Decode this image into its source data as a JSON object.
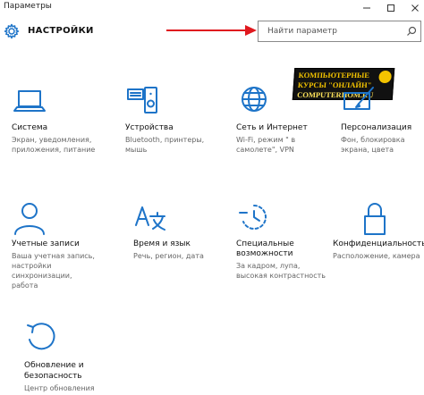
{
  "window": {
    "title": "Параметры"
  },
  "header": {
    "title": "НАСТРОЙКИ"
  },
  "search": {
    "placeholder": "Найти параметр"
  },
  "watermark": {
    "line1": "КОМПЬЮТЕРНЫЕ",
    "line2": "КУРСЫ \"ОНЛАЙН\"",
    "line3": "COMPUTERHOM.RU"
  },
  "accent": "#1e74c8",
  "tiles": [
    {
      "name": "Система",
      "icon": "laptop-icon",
      "desc": [
        "Экран, уведомления,",
        "приложения, питание"
      ]
    },
    {
      "name": "Устройства",
      "icon": "devices-icon",
      "desc": [
        "Bluetooth, принтеры,",
        "мышь"
      ]
    },
    {
      "name": "Сеть и Интернет",
      "icon": "globe-icon",
      "desc": [
        "Wi-Fi, режим \" в",
        "самолете\", VPN"
      ]
    },
    {
      "name": "Персонализация",
      "icon": "personalization-icon",
      "desc": [
        "Фон, блокировка",
        "экрана, цвета"
      ]
    },
    {
      "name": "Учетные записи",
      "icon": "user-icon",
      "desc": [
        "Ваша учетная запись,",
        "настройки",
        "синхронизации,",
        "работа"
      ]
    },
    {
      "name": "Время и язык",
      "icon": "language-icon",
      "desc": [
        "Речь, регион, дата"
      ]
    },
    {
      "name": "Специальные",
      "name2": "возможности",
      "icon": "accessibility-icon",
      "desc": [
        "За кадром, лупа,",
        "высокая контрастность"
      ]
    },
    {
      "name": "Конфиденциальность",
      "icon": "lock-icon",
      "desc": [
        "Расположение, камера"
      ]
    },
    {
      "name": "Обновление и",
      "name2": "безопасность",
      "icon": "update-icon",
      "desc": [
        "Центр обновления"
      ]
    }
  ]
}
